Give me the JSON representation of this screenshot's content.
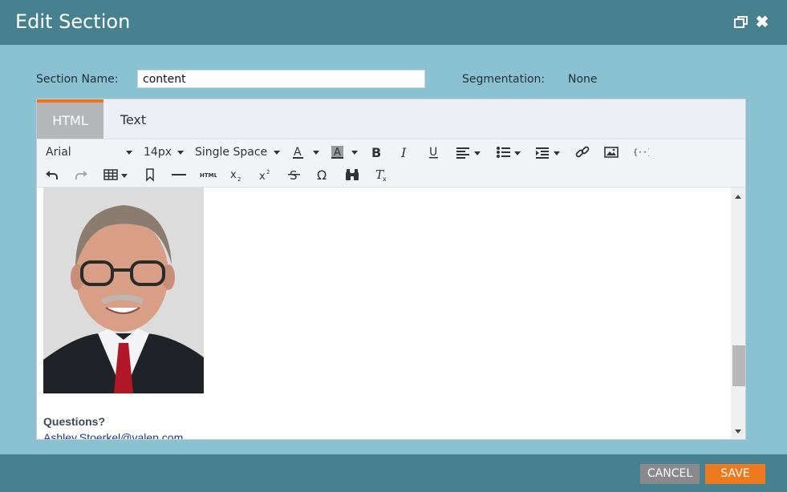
{
  "dialog": {
    "title": "Edit Section",
    "restore_icon": "restore-window-icon",
    "close_icon": "close-icon"
  },
  "form": {
    "section_name_label": "Section Name:",
    "section_name_value": "content",
    "segmentation_label": "Segmentation:",
    "segmentation_value": "None"
  },
  "tabs": [
    {
      "label": "HTML",
      "active": true
    },
    {
      "label": "Text",
      "active": false
    }
  ],
  "toolbar": {
    "font_family": "Arial",
    "font_size": "14px",
    "line_spacing": "Single Space",
    "html_label": "HTML"
  },
  "content": {
    "questions": "Questions?",
    "email": "Ashley.Stoerkel@valen.com"
  },
  "footer": {
    "cancel": "CANCEL",
    "save": "SAVE"
  },
  "colors": {
    "header": "#47808f",
    "body": "#8bc2d2",
    "accent": "#e9761f",
    "save": "#ee7a1f",
    "cancel": "#8a8a8a"
  }
}
